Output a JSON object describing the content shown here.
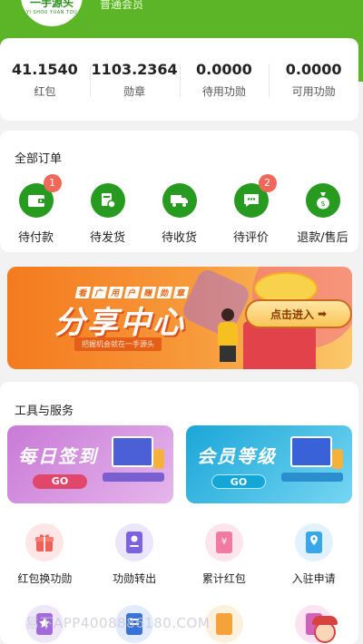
{
  "header": {
    "logo_text": "一手源头",
    "logo_subtext": "YI SHOU YUAN TOU",
    "member_level": "普通会员"
  },
  "stats": [
    {
      "value": "41.1540",
      "label": "红包"
    },
    {
      "value": "1103.2364",
      "label": "勋章"
    },
    {
      "value": "0.0000",
      "label": "待用功勋"
    },
    {
      "value": "0.0000",
      "label": "可用功勋"
    }
  ],
  "orders": {
    "title": "全部订单",
    "items": [
      {
        "label": "待付款",
        "badge": "1",
        "icon": "wallet-icon"
      },
      {
        "label": "待发货",
        "badge": "",
        "icon": "package-icon"
      },
      {
        "label": "待收货",
        "badge": "",
        "icon": "truck-icon"
      },
      {
        "label": "待评价",
        "badge": "2",
        "icon": "comment-icon"
      },
      {
        "label": "退款/售后",
        "badge": "",
        "icon": "money-bag-icon"
      }
    ]
  },
  "banner": {
    "sub_top_chars": [
      "看",
      "广",
      "用",
      "户",
      "赚",
      "勋",
      "章"
    ],
    "title": "分享中心",
    "tagline": "把握机会就在一手源头",
    "button_label": "点击进入",
    "button_arrow": "➡"
  },
  "tools": {
    "title": "工具与服务",
    "signin_tile": {
      "title": "每日签到",
      "go": "GO"
    },
    "level_tile": {
      "title": "会员等级",
      "go": "GO"
    },
    "services_row1": [
      {
        "label": "红包换功勋",
        "icon": "gift-icon",
        "color": "#f0605b",
        "bg": "#fde6e5"
      },
      {
        "label": "功勋转出",
        "icon": "card-icon",
        "color": "#7b62e0",
        "bg": "#ebe6fb"
      },
      {
        "label": "累计红包",
        "icon": "coupon-icon",
        "color": "#f07aa0",
        "bg": "#fde4ed"
      },
      {
        "label": "入驻申请",
        "icon": "location-pin-icon",
        "color": "#3aa6ea",
        "bg": "#e1f1fd"
      }
    ],
    "services_row2": [
      {
        "icon": "star-card-icon",
        "color": "#a06bd8",
        "bg": "#efe6fa"
      },
      {
        "icon": "document-icon",
        "color": "#3a72d8",
        "bg": "#e2ebfb"
      },
      {
        "icon": "orange-card-icon",
        "color": "#f4a23a",
        "bg": "#fdf0dd"
      },
      {
        "icon": "purple-card-icon",
        "color": "#d063b8",
        "bg": "#fbe3f4"
      }
    ]
  },
  "watermark": "易下APP4008886180.COM"
}
